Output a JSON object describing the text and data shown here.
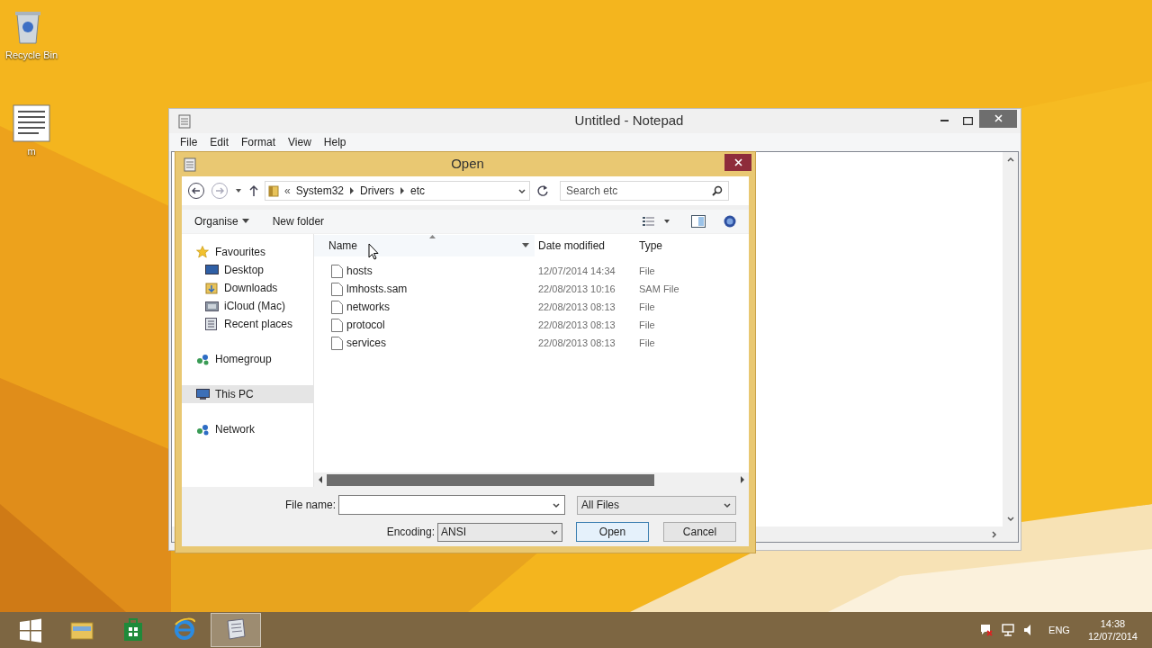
{
  "desktop_icons": [
    {
      "label": "Recycle Bin"
    },
    {
      "label": "m"
    }
  ],
  "notepad": {
    "title": "Untitled - Notepad",
    "menu": [
      "File",
      "Edit",
      "Format",
      "View",
      "Help"
    ]
  },
  "dialog": {
    "title": "Open",
    "breadcrumb": [
      "System32",
      "Drivers",
      "etc"
    ],
    "breadcrumb_prefix": "«",
    "search": {
      "placeholder": "Search etc"
    },
    "toolbar": {
      "organise": "Organise",
      "new_folder": "New folder"
    },
    "nav": [
      {
        "label": "Favourites",
        "selected": false,
        "children": [
          {
            "label": "Desktop",
            "selected": false
          },
          {
            "label": "Downloads",
            "selected": false
          },
          {
            "label": "iCloud (Mac)",
            "selected": false
          },
          {
            "label": "Recent places",
            "selected": false
          }
        ]
      },
      {
        "label": "Homegroup",
        "selected": false
      },
      {
        "label": "This PC",
        "selected": true
      },
      {
        "label": "Network",
        "selected": false
      }
    ],
    "columns": [
      "Name",
      "Date modified",
      "Type"
    ],
    "files": [
      {
        "name": "hosts",
        "date": "12/07/2014 14:34",
        "type": "File"
      },
      {
        "name": "lmhosts.sam",
        "date": "22/08/2013 10:16",
        "type": "SAM File"
      },
      {
        "name": "networks",
        "date": "22/08/2013 08:13",
        "type": "File"
      },
      {
        "name": "protocol",
        "date": "22/08/2013 08:13",
        "type": "File"
      },
      {
        "name": "services",
        "date": "22/08/2013 08:13",
        "type": "File"
      }
    ],
    "file_name": {
      "label": "File name:"
    },
    "filter": "All Files",
    "encoding": {
      "label": "Encoding:",
      "value": "ANSI"
    },
    "buttons": [
      "Open",
      "Cancel"
    ]
  },
  "taskbar": {
    "apps": [
      {
        "selected": false
      },
      {
        "selected": false
      },
      {
        "selected": false
      },
      {
        "selected": false
      },
      {
        "selected": true
      }
    ],
    "language": "ENG",
    "time": "14:38",
    "date": "12/07/2014"
  }
}
